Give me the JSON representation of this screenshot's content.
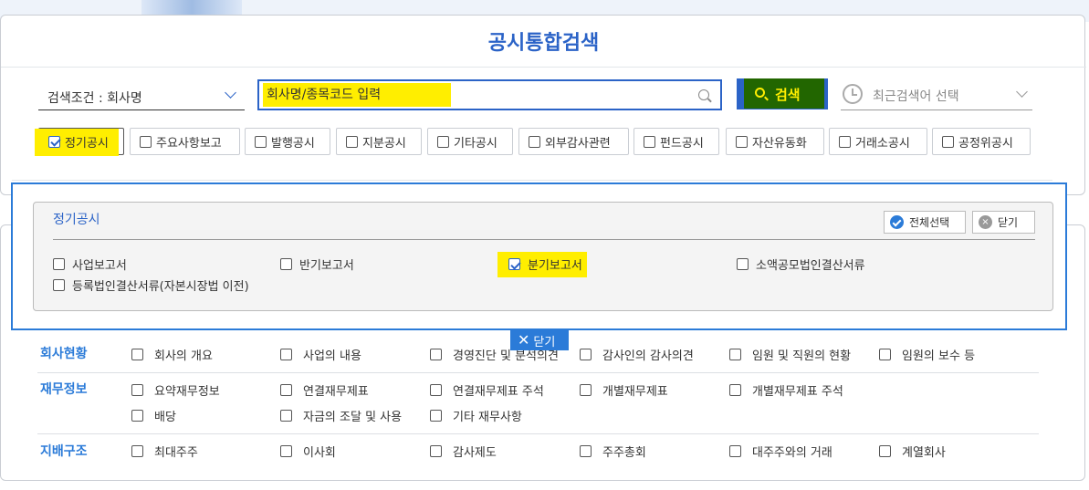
{
  "header": {
    "title": "공시통합검색"
  },
  "search": {
    "condition_label": "검색조건 : 회사명",
    "placeholder": "회사명/종목코드 입력",
    "button_label": "검색",
    "recent_label": "최근검색어 선택"
  },
  "disclosure_types": [
    {
      "label": "정기공시",
      "checked": true
    },
    {
      "label": "주요사항보고",
      "checked": false
    },
    {
      "label": "발행공시",
      "checked": false
    },
    {
      "label": "지분공시",
      "checked": false
    },
    {
      "label": "기타공시",
      "checked": false
    },
    {
      "label": "외부감사관련",
      "checked": false
    },
    {
      "label": "펀드공시",
      "checked": false
    },
    {
      "label": "자산유동화",
      "checked": false
    },
    {
      "label": "거래소공시",
      "checked": false
    },
    {
      "label": "공정위공시",
      "checked": false
    }
  ],
  "panel": {
    "title": "정기공시",
    "select_all_label": "전체선택",
    "close_label": "닫기",
    "items": [
      {
        "label": "사업보고서",
        "checked": false
      },
      {
        "label": "반기보고서",
        "checked": false
      },
      {
        "label": "분기보고서",
        "checked": true
      },
      {
        "label": "소액공모법인결산서류",
        "checked": false
      },
      {
        "label": "등록법인결산서류(자본시장법 이전)",
        "checked": false
      }
    ]
  },
  "close_tab_label": "닫기",
  "categories": [
    {
      "label": "회사현황",
      "items": [
        "회사의 개요",
        "사업의 내용",
        "경영진단 및 분석의견",
        "감사인의 감사의견",
        "임원 및 직원의 현황",
        "임원의 보수 등"
      ]
    },
    {
      "label": "재무정보",
      "items": [
        "요약재무정보",
        "연결재무제표",
        "연결재무제표 주석",
        "개별재무제표",
        "개별재무제표 주석",
        "배당",
        "자금의 조달 및 사용",
        "기타 재무사항"
      ]
    },
    {
      "label": "지배구조",
      "items": [
        "최대주주",
        "이사회",
        "감사제도",
        "주주총회",
        "대주주와의 거래",
        "계열회사"
      ]
    }
  ],
  "colors": {
    "accent": "#2b63c7",
    "frame": "#2b7bd8",
    "highlight": "#ffee00",
    "button_highlight": "#226600"
  }
}
